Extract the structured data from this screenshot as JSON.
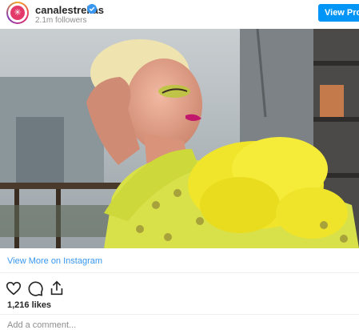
{
  "header": {
    "username": "canalestrellas",
    "followers": "2.1m followers",
    "view_profile": "View Profile",
    "avatar_icon": "star-burst-icon",
    "verified_icon": "verified-badge-icon",
    "verified_color": "#3897f0"
  },
  "post": {
    "photo_alt": "woman-in-yellow-feather-outfit-photo",
    "view_more": "View More on Instagram",
    "likes": "1,216 likes",
    "comment_placeholder": "Add a comment..."
  },
  "actions": [
    {
      "icon": "heart-icon"
    },
    {
      "icon": "comment-icon"
    },
    {
      "icon": "share-icon"
    }
  ],
  "colors": {
    "accent": "#0095f6",
    "link": "#3897f0",
    "muted": "#8e8e8e"
  }
}
